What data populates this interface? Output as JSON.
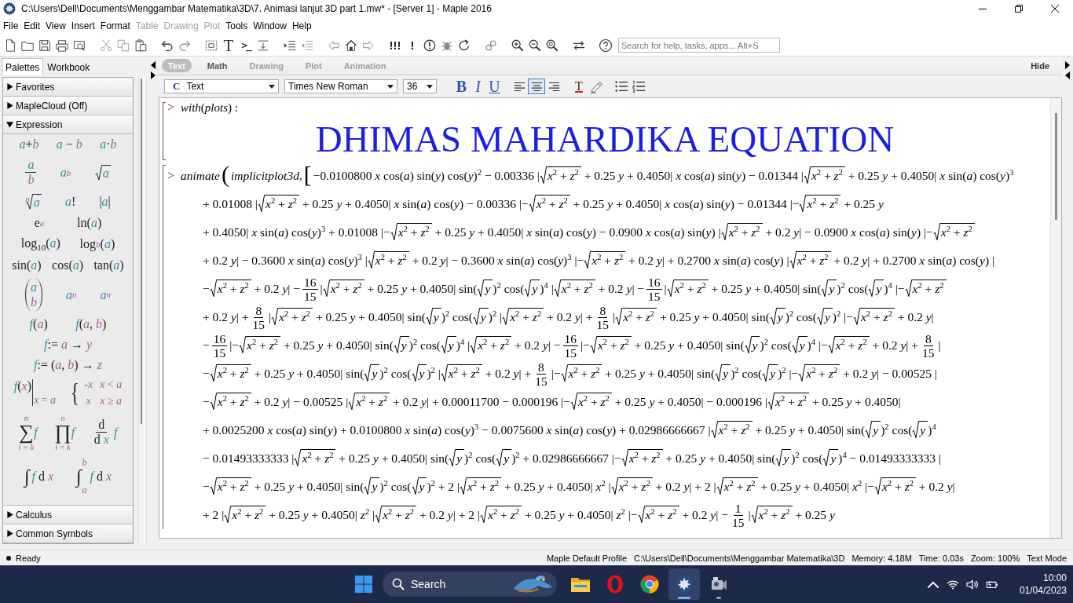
{
  "window": {
    "title": "C:\\Users\\Dell\\Documents\\Menggambar Matematika\\3D\\7. Animasi lanjut 3D part 1.mw* - [Server 1] - Maple 2016"
  },
  "menu": [
    {
      "label": "File",
      "disabled": false
    },
    {
      "label": "Edit",
      "disabled": false
    },
    {
      "label": "View",
      "disabled": false
    },
    {
      "label": "Insert",
      "disabled": false
    },
    {
      "label": "Format",
      "disabled": false
    },
    {
      "label": "Table",
      "disabled": true
    },
    {
      "label": "Drawing",
      "disabled": true
    },
    {
      "label": "Plot",
      "disabled": true
    },
    {
      "label": "Tools",
      "disabled": false
    },
    {
      "label": "Window",
      "disabled": false
    },
    {
      "label": "Help",
      "disabled": false
    }
  ],
  "toolbar": {
    "text_glyph": "T",
    "math_glyph": ">_",
    "execute_all": "!!!",
    "execute": "!",
    "search": {
      "placeholder": "Search for help, tasks, apps... Alt+S"
    }
  },
  "panel_tabs": [
    {
      "label": "Palettes",
      "selected": true
    },
    {
      "label": "Workbook",
      "selected": false
    }
  ],
  "palette_sections": [
    {
      "title": "Favorites",
      "expanded": false
    },
    {
      "title": "MapleCloud (Off)",
      "expanded": false
    },
    {
      "title": "Expression",
      "expanded": true,
      "rows": [
        [
          {
            "kind": "inline",
            "s": "*a*+*b*"
          },
          {
            "kind": "inline",
            "s": "*a* − *b*"
          },
          {
            "kind": "inline",
            "s": "*a*·*b*"
          }
        ],
        [
          {
            "kind": "frac",
            "num": "a",
            "den": "b"
          },
          {
            "kind": "power",
            "base": "a",
            "script": "b"
          },
          {
            "kind": "sqrt",
            "s": "a"
          }
        ],
        [
          {
            "kind": "root",
            "index": "n",
            "s": "a"
          },
          {
            "kind": "inline",
            "s": "*a*!"
          },
          {
            "kind": "inline",
            "s": "|*a*|"
          }
        ],
        [
          {
            "kind": "exp",
            "base": "e",
            "script": "a"
          },
          {
            "kind": "inline",
            "s": "ln(*a*)"
          }
        ],
        [
          {
            "kind": "inline",
            "s": "log$_{10}$(*a*)"
          },
          {
            "kind": "log",
            "base": "log",
            "script": "b",
            "tail": "(*a*)"
          }
        ],
        [
          {
            "kind": "inline",
            "s": "sin(*a*)"
          },
          {
            "kind": "inline",
            "s": "cos(*a*)"
          },
          {
            "kind": "inline",
            "s": "tan(*a*)"
          }
        ],
        [
          {
            "kind": "binom",
            "top": "a",
            "bottom": "b"
          },
          {
            "kind": "subscript",
            "base": "a",
            "script": "n"
          },
          {
            "kind": "subscript",
            "base": "a",
            "script": "n"
          }
        ],
        [
          {
            "kind": "inline",
            "s": "*f*(*a*)"
          },
          {
            "kind": "inline",
            "s": "*f*(*a*, *b*)"
          }
        ],
        [
          {
            "kind": "inline",
            "s": "*f*:= *a* → *y*"
          }
        ],
        [
          {
            "kind": "inline",
            "s": "*f*:= (*a*, *b*) → *z*"
          }
        ],
        [
          {
            "kind": "eval",
            "body": "*f*(*x*)",
            "at": "*x* = *a*"
          },
          {
            "kind": "piecewise",
            "brace": "{",
            "cases": [
              {
                "value": "-*x*",
                "condition": "*x* < *a*"
              },
              {
                "value": "*x*",
                "condition": "*x* ≥ *a*"
              }
            ]
          }
        ],
        [
          {
            "kind": "bigop",
            "symbol": "∑",
            "upper": "n",
            "lower": "*i* = *k*",
            "body": "f"
          },
          {
            "kind": "bigop",
            "symbol": "∏",
            "upper": "n",
            "lower": "*i* = *k*",
            "body": "f"
          },
          {
            "kind": "deriv",
            "num": "d",
            "den": "d *x*",
            "body": "f"
          }
        ],
        [
          {
            "kind": "integral",
            "symbol": "∫",
            "body": "*f* d *x*"
          },
          {
            "kind": "integral",
            "symbol": "∫",
            "upper": "b",
            "lower": "a",
            "body": "*f* d *x*"
          }
        ]
      ]
    },
    {
      "title": "Calculus",
      "expanded": false
    },
    {
      "title": "Common Symbols",
      "expanded": false
    }
  ],
  "context_bar": {
    "tabs": [
      {
        "label": "Text",
        "selected": true,
        "disabled": false
      },
      {
        "label": "Math",
        "selected": false,
        "disabled": false
      },
      {
        "label": "Drawing",
        "selected": false,
        "disabled": true
      },
      {
        "label": "Plot",
        "selected": false,
        "disabled": true
      },
      {
        "label": "Animation",
        "selected": false,
        "disabled": true
      }
    ],
    "hide": "Hide"
  },
  "format_bar": {
    "style_prefix": "C",
    "style": "Text",
    "font": "Times New Roman",
    "size": "36",
    "bold": "B",
    "italic": "I",
    "underline": "U",
    "alignment": [
      {
        "kind": "left",
        "selected": false
      },
      {
        "kind": "center",
        "selected": true
      },
      {
        "kind": "right",
        "selected": false
      }
    ],
    "text_color": "T"
  },
  "document": {
    "input": {
      "prompt": ">",
      "text": "*with*(*plots*) :"
    },
    "title": "DHIMAS MAHARDIKA EQUATION",
    "command": {
      "prompt": ">",
      "lines": [
        [
          {
            "kind": "fn",
            "s": "animate"
          },
          {
            "kind": "big",
            "s": "("
          },
          {
            "kind": "fn",
            "s": "implicitplot3d,"
          },
          {
            "kind": "big",
            "s": "["
          },
          {
            "kind": "text",
            "s": "−0.0100800 *x* cos(*a*) sin(*y*) cos(*y*)$^{2}$ − 0.00336 |"
          },
          {
            "kind": "sqrt",
            "s": "*x*$^{2}$ + *z*$^{2}$"
          },
          {
            "kind": "text",
            "s": " + 0.25 *y* + 0.4050| *x* cos(*a*) sin(*y*) − 0.01344 |"
          },
          {
            "kind": "sqrt",
            "s": "*x*$^{2}$ + *z*$^{2}$"
          },
          {
            "kind": "text",
            "s": " + 0.25 *y* + 0.4050| *x* sin(*a*) cos(*y*)$^{3}$"
          }
        ],
        [
          {
            "kind": "text",
            "s": "+ 0.01008 |"
          },
          {
            "kind": "sqrt",
            "s": "*x*$^{2}$ + *z*$^{2}$"
          },
          {
            "kind": "text",
            "s": " + 0.25 *y* + 0.4050| *x* sin(*a*) cos(*y*) − 0.00336 |−"
          },
          {
            "kind": "sqrt",
            "s": "*x*$^{2}$ + *z*$^{2}$"
          },
          {
            "kind": "text",
            "s": " + 0.25 *y* + 0.4050| *x* cos(*a*) sin(*y*) − 0.01344 |−"
          },
          {
            "kind": "sqrt",
            "s": "*x*$^{2}$ + *z*$^{2}$"
          },
          {
            "kind": "text",
            "s": " + 0.25 *y*"
          }
        ],
        [
          {
            "kind": "text",
            "s": "+ 0.4050| *x* sin(*a*) cos(*y*)$^{3}$ + 0.01008 |−"
          },
          {
            "kind": "sqrt",
            "s": "*x*$^{2}$ + *z*$^{2}$"
          },
          {
            "kind": "text",
            "s": " + 0.25 *y* + 0.4050| *x* sin(*a*) cos(*y*) − 0.0900 *x* cos(*a*) sin(*y*) |"
          },
          {
            "kind": "sqrt",
            "s": "*x*$^{2}$ + *z*$^{2}$"
          },
          {
            "kind": "text",
            "s": " + 0.2 *y*| − 0.0900 *x* cos(*a*) sin(*y*) |−"
          },
          {
            "kind": "sqrt",
            "s": "*x*$^{2}$ + *z*$^{2}$"
          }
        ],
        [
          {
            "kind": "text",
            "s": "+ 0.2 *y*| − 0.3600 *x* sin(*a*) cos(*y*)$^{3}$ |"
          },
          {
            "kind": "sqrt",
            "s": "*x*$^{2}$ + *z*$^{2}$"
          },
          {
            "kind": "text",
            "s": " + 0.2 *y*| − 0.3600 *x* sin(*a*) cos(*y*)$^{3}$ |−"
          },
          {
            "kind": "sqrt",
            "s": "*x*$^{2}$ + *z*$^{2}$"
          },
          {
            "kind": "text",
            "s": " + 0.2 *y*| + 0.2700 *x* sin(*a*) cos(*y*) |"
          },
          {
            "kind": "sqrt",
            "s": "*x*$^{2}$ + *z*$^{2}$"
          },
          {
            "kind": "text",
            "s": " + 0.2 *y*| + 0.2700 *x* sin(*a*) cos(*y*) |"
          }
        ],
        [
          {
            "kind": "text",
            "s": "−"
          },
          {
            "kind": "sqrt",
            "s": "*x*$^{2}$ + *z*$^{2}$"
          },
          {
            "kind": "text",
            "s": " + 0.2 *y*| −"
          },
          {
            "kind": "frac",
            "num": "16",
            "den": "15"
          },
          {
            "kind": "text",
            "s": "|"
          },
          {
            "kind": "sqrt",
            "s": "*x*$^{2}$ + *z*$^{2}$"
          },
          {
            "kind": "text",
            "s": " + 0.25 *y* + 0.4050| sin("
          },
          {
            "kind": "sqrt",
            "s": "y",
            "italic": true
          },
          {
            "kind": "text",
            "s": ")$^{2}$ cos("
          },
          {
            "kind": "sqrt",
            "s": "y",
            "italic": true
          },
          {
            "kind": "text",
            "s": ")$^{4}$ |"
          },
          {
            "kind": "sqrt",
            "s": "*x*$^{2}$ + *z*$^{2}$"
          },
          {
            "kind": "text",
            "s": " + 0.2 *y*| −"
          },
          {
            "kind": "frac",
            "num": "16",
            "den": "15"
          },
          {
            "kind": "text",
            "s": "|"
          },
          {
            "kind": "sqrt",
            "s": "*x*$^{2}$ + *z*$^{2}$"
          },
          {
            "kind": "text",
            "s": " + 0.25 *y* + 0.4050| sin("
          },
          {
            "kind": "sqrt",
            "s": "y",
            "italic": true
          },
          {
            "kind": "text",
            "s": ")$^{2}$ cos("
          },
          {
            "kind": "sqrt",
            "s": "y",
            "italic": true
          },
          {
            "kind": "text",
            "s": ")$^{4}$ |−"
          },
          {
            "kind": "sqrt",
            "s": "*x*$^{2}$ + *z*$^{2}$"
          }
        ],
        [
          {
            "kind": "text",
            "s": "+ 0.2 *y*| +"
          },
          {
            "kind": "frac",
            "num": "8",
            "den": "15"
          },
          {
            "kind": "text",
            "s": "|"
          },
          {
            "kind": "sqrt",
            "s": "*x*$^{2}$ + *z*$^{2}$"
          },
          {
            "kind": "text",
            "s": " + 0.25 *y* + 0.4050| sin("
          },
          {
            "kind": "sqrt",
            "s": "y",
            "italic": true
          },
          {
            "kind": "text",
            "s": ")$^{2}$ cos("
          },
          {
            "kind": "sqrt",
            "s": "y",
            "italic": true
          },
          {
            "kind": "text",
            "s": ")$^{2}$ |"
          },
          {
            "kind": "sqrt",
            "s": "*x*$^{2}$ + *z*$^{2}$"
          },
          {
            "kind": "text",
            "s": " + 0.2 *y*| +"
          },
          {
            "kind": "frac",
            "num": "8",
            "den": "15"
          },
          {
            "kind": "text",
            "s": "|"
          },
          {
            "kind": "sqrt",
            "s": "*x*$^{2}$ + *z*$^{2}$"
          },
          {
            "kind": "text",
            "s": " + 0.25 *y* + 0.4050| sin("
          },
          {
            "kind": "sqrt",
            "s": "y",
            "italic": true
          },
          {
            "kind": "text",
            "s": ")$^{2}$ cos("
          },
          {
            "kind": "sqrt",
            "s": "y",
            "italic": true
          },
          {
            "kind": "text",
            "s": ")$^{2}$ |−"
          },
          {
            "kind": "sqrt",
            "s": "*x*$^{2}$ + *z*$^{2}$"
          },
          {
            "kind": "text",
            "s": " + 0.2 *y*|"
          }
        ],
        [
          {
            "kind": "text",
            "s": "−"
          },
          {
            "kind": "frac",
            "num": "16",
            "den": "15"
          },
          {
            "kind": "text",
            "s": "|−"
          },
          {
            "kind": "sqrt",
            "s": "*x*$^{2}$ + *z*$^{2}$"
          },
          {
            "kind": "text",
            "s": " + 0.25 *y* + 0.4050| sin("
          },
          {
            "kind": "sqrt",
            "s": "y",
            "italic": true
          },
          {
            "kind": "text",
            "s": ")$^{2}$ cos("
          },
          {
            "kind": "sqrt",
            "s": "y",
            "italic": true
          },
          {
            "kind": "text",
            "s": ")$^{4}$ |"
          },
          {
            "kind": "sqrt",
            "s": "*x*$^{2}$ + *z*$^{2}$"
          },
          {
            "kind": "text",
            "s": " + 0.2 *y*| −"
          },
          {
            "kind": "frac",
            "num": "16",
            "den": "15"
          },
          {
            "kind": "text",
            "s": "|−"
          },
          {
            "kind": "sqrt",
            "s": "*x*$^{2}$ + *z*$^{2}$"
          },
          {
            "kind": "text",
            "s": " + 0.25 *y* + 0.4050| sin("
          },
          {
            "kind": "sqrt",
            "s": "y",
            "italic": true
          },
          {
            "kind": "text",
            "s": ")$^{2}$ cos("
          },
          {
            "kind": "sqrt",
            "s": "y",
            "italic": true
          },
          {
            "kind": "text",
            "s": ")$^{4}$ |−"
          },
          {
            "kind": "sqrt",
            "s": "*x*$^{2}$ + *z*$^{2}$"
          },
          {
            "kind": "text",
            "s": " + 0.2 *y*| +"
          },
          {
            "kind": "frac",
            "num": "8",
            "den": "15"
          },
          {
            "kind": "text",
            "s": "|"
          }
        ],
        [
          {
            "kind": "text",
            "s": "−"
          },
          {
            "kind": "sqrt",
            "s": "*x*$^{2}$ + *z*$^{2}$"
          },
          {
            "kind": "text",
            "s": " + 0.25 *y* + 0.4050| sin("
          },
          {
            "kind": "sqrt",
            "s": "y",
            "italic": true
          },
          {
            "kind": "text",
            "s": ")$^{2}$ cos("
          },
          {
            "kind": "sqrt",
            "s": "y",
            "italic": true
          },
          {
            "kind": "text",
            "s": ")$^{2}$ |"
          },
          {
            "kind": "sqrt",
            "s": "*x*$^{2}$ + *z*$^{2}$"
          },
          {
            "kind": "text",
            "s": " + 0.2 *y*| +"
          },
          {
            "kind": "frac",
            "num": "8",
            "den": "15"
          },
          {
            "kind": "text",
            "s": "|−"
          },
          {
            "kind": "sqrt",
            "s": "*x*$^{2}$ + *z*$^{2}$"
          },
          {
            "kind": "text",
            "s": " + 0.25 *y* + 0.4050| sin("
          },
          {
            "kind": "sqrt",
            "s": "y",
            "italic": true
          },
          {
            "kind": "text",
            "s": ")$^{2}$ cos("
          },
          {
            "kind": "sqrt",
            "s": "y",
            "italic": true
          },
          {
            "kind": "text",
            "s": ")$^{2}$ |−"
          },
          {
            "kind": "sqrt",
            "s": "*x*$^{2}$ + *z*$^{2}$"
          },
          {
            "kind": "text",
            "s": " + 0.2 *y*| − 0.00525 |"
          }
        ],
        [
          {
            "kind": "text",
            "s": "−"
          },
          {
            "kind": "sqrt",
            "s": "*x*$^{2}$ + *z*$^{2}$"
          },
          {
            "kind": "text",
            "s": " + 0.2 *y*| − 0.00525 |"
          },
          {
            "kind": "sqrt",
            "s": "*x*$^{2}$ + *z*$^{2}$"
          },
          {
            "kind": "text",
            "s": " + 0.2 *y*| + 0.00011700 − 0.000196 |−"
          },
          {
            "kind": "sqrt",
            "s": "*x*$^{2}$ + *z*$^{2}$"
          },
          {
            "kind": "text",
            "s": " + 0.25 *y* + 0.4050| − 0.000196 |"
          },
          {
            "kind": "sqrt",
            "s": "*x*$^{2}$ + *z*$^{2}$"
          },
          {
            "kind": "text",
            "s": " + 0.25 *y* + 0.4050|"
          }
        ],
        [
          {
            "kind": "text",
            "s": "+ 0.0025200 *x* cos(*a*) sin(*y*) + 0.0100800 *x* sin(*a*) cos(*y*)$^{3}$ − 0.0075600 *x* sin(*a*) cos(*y*) + 0.02986666667 |"
          },
          {
            "kind": "sqrt",
            "s": "*x*$^{2}$ + *z*$^{2}$"
          },
          {
            "kind": "text",
            "s": " + 0.25 *y* + 0.4050| sin("
          },
          {
            "kind": "sqrt",
            "s": "y",
            "italic": true
          },
          {
            "kind": "text",
            "s": ")$^{2}$ cos("
          },
          {
            "kind": "sqrt",
            "s": "y",
            "italic": true
          },
          {
            "kind": "text",
            "s": ")$^{4}$"
          }
        ],
        [
          {
            "kind": "text",
            "s": "− 0.01493333333 |"
          },
          {
            "kind": "sqrt",
            "s": "*x*$^{2}$ + *z*$^{2}$"
          },
          {
            "kind": "text",
            "s": " + 0.25 *y* + 0.4050| sin("
          },
          {
            "kind": "sqrt",
            "s": "y",
            "italic": true
          },
          {
            "kind": "text",
            "s": ")$^{2}$ cos("
          },
          {
            "kind": "sqrt",
            "s": "y",
            "italic": true
          },
          {
            "kind": "text",
            "s": ")$^{2}$ + 0.02986666667 |−"
          },
          {
            "kind": "sqrt",
            "s": "*x*$^{2}$ + *z*$^{2}$"
          },
          {
            "kind": "text",
            "s": " + 0.25 *y* + 0.4050| sin("
          },
          {
            "kind": "sqrt",
            "s": "y",
            "italic": true
          },
          {
            "kind": "text",
            "s": ")$^{2}$ cos("
          },
          {
            "kind": "sqrt",
            "s": "y",
            "italic": true
          },
          {
            "kind": "text",
            "s": ")$^{4}$ − 0.01493333333 |"
          }
        ],
        [
          {
            "kind": "text",
            "s": "−"
          },
          {
            "kind": "sqrt",
            "s": "*x*$^{2}$ + *z*$^{2}$"
          },
          {
            "kind": "text",
            "s": " + 0.25 *y* + 0.4050| sin("
          },
          {
            "kind": "sqrt",
            "s": "y",
            "italic": true
          },
          {
            "kind": "text",
            "s": ")$^{2}$ cos("
          },
          {
            "kind": "sqrt",
            "s": "y",
            "italic": true
          },
          {
            "kind": "text",
            "s": ")$^{2}$ + 2 |"
          },
          {
            "kind": "sqrt",
            "s": "*x*$^{2}$ + *z*$^{2}$"
          },
          {
            "kind": "text",
            "s": " + 0.25 *y* + 0.4050| *x*$^{2}$ |"
          },
          {
            "kind": "sqrt",
            "s": "*x*$^{2}$ + *z*$^{2}$"
          },
          {
            "kind": "text",
            "s": " + 0.2 *y*| + 2 |"
          },
          {
            "kind": "sqrt",
            "s": "*x*$^{2}$ + *z*$^{2}$"
          },
          {
            "kind": "text",
            "s": " + 0.25 *y* + 0.4050| *x*$^{2}$ |−"
          },
          {
            "kind": "sqrt",
            "s": "*x*$^{2}$ + *z*$^{2}$"
          },
          {
            "kind": "text",
            "s": " + 0.2 *y*|"
          }
        ],
        [
          {
            "kind": "text",
            "s": "+ 2 |"
          },
          {
            "kind": "sqrt",
            "s": "*x*$^{2}$ + *z*$^{2}$"
          },
          {
            "kind": "text",
            "s": " + 0.25 *y* + 0.4050| *z*$^{2}$ |"
          },
          {
            "kind": "sqrt",
            "s": "*x*$^{2}$ + *z*$^{2}$"
          },
          {
            "kind": "text",
            "s": " + 0.2 *y*| + 2 |"
          },
          {
            "kind": "sqrt",
            "s": "*x*$^{2}$ + *z*$^{2}$"
          },
          {
            "kind": "text",
            "s": " + 0.25 *y* + 0.4050| *z*$^{2}$ |−"
          },
          {
            "kind": "sqrt",
            "s": "*x*$^{2}$ + *z*$^{2}$"
          },
          {
            "kind": "text",
            "s": " + 0.2 *y*| −"
          },
          {
            "kind": "frac",
            "num": "1",
            "den": "15"
          },
          {
            "kind": "text",
            "s": "|"
          },
          {
            "kind": "sqrt",
            "s": "*x*$^{2}$ + *z*$^{2}$"
          },
          {
            "kind": "text",
            "s": " + 0.25 *y*"
          }
        ]
      ]
    }
  },
  "status_bar": {
    "state": "Ready",
    "items": [
      "Maple Default Profile",
      "C:\\Users\\Dell\\Documents\\Menggambar Matematika\\3D",
      "Memory: 4.18M",
      "Time: 0.03s",
      "Zoom: 100%",
      "Text Mode"
    ]
  },
  "taskbar": {
    "search": "Search",
    "apps": [
      {
        "kind": "folder",
        "selected": false,
        "running": false
      },
      {
        "kind": "ring",
        "selected": false,
        "running": false
      },
      {
        "kind": "browser",
        "selected": false,
        "running": false
      },
      {
        "kind": "leaf",
        "selected": true,
        "running": true
      },
      {
        "kind": "camera",
        "selected": false,
        "running": true
      }
    ],
    "time": "10:00",
    "date": "01/04/2023"
  }
}
